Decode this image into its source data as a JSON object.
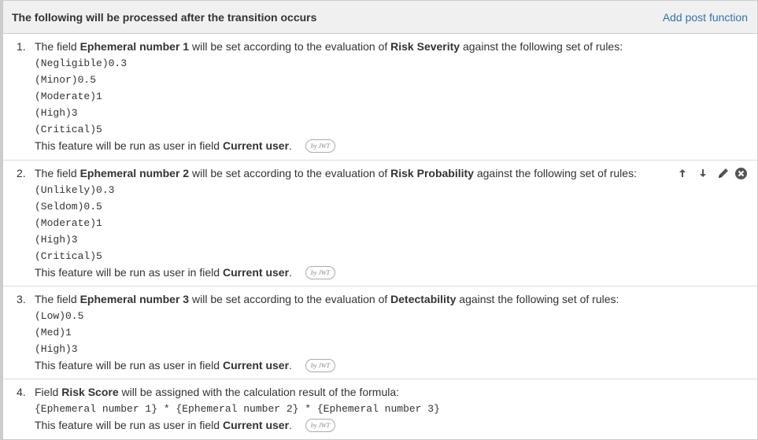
{
  "header": {
    "title": "The following will be processed after the transition occurs",
    "add_link": "Add post function"
  },
  "items": [
    {
      "num": "1.",
      "pre": "The field ",
      "field": "Ephemeral number 1",
      "mid": " will be set according to the evaluation of ",
      "source": "Risk Severity",
      "post": " against the following set of rules:",
      "rules": [
        "(Negligible)0.3",
        "(Minor)0.5",
        "(Moderate)1",
        "(High)3",
        "(Critical)5"
      ],
      "runas_text": "This feature will be run as user in field",
      "runas_field": "Current user",
      "runas_dot": ".",
      "badge": "by JWT"
    },
    {
      "num": "2.",
      "pre": "The field ",
      "field": "Ephemeral number 2",
      "mid": " will be set according to the evaluation of ",
      "source": "Risk Probability",
      "post": " against the following set of rules:",
      "rules": [
        "(Unlikely)0.3",
        "(Seldom)0.5",
        "(Moderate)1",
        "(High)3",
        "(Critical)5"
      ],
      "runas_text": "This feature will be run as user in field",
      "runas_field": "Current user",
      "runas_dot": ".",
      "badge": "by JWT"
    },
    {
      "num": "3.",
      "pre": "The field ",
      "field": "Ephemeral number 3",
      "mid": " will be set according to the evaluation of ",
      "source": "Detectability",
      "post": " against the following set of rules:",
      "rules": [
        "(Low)0.5",
        "(Med)1",
        "(High)3"
      ],
      "runas_text": "This feature will be run as user in field",
      "runas_field": "Current user",
      "runas_dot": ".",
      "badge": "by JWT"
    },
    {
      "num": "4.",
      "pre": "Field ",
      "field": "Risk Score",
      "post": " will be assigned with the calculation result of the formula:",
      "formula": "{Ephemeral number 1} * {Ephemeral number 2} * {Ephemeral number 3}",
      "runas_text": "This feature will be run as user in field",
      "runas_field": "Current user",
      "runas_dot": ".",
      "badge": "by JWT"
    }
  ],
  "icons": {
    "move_up": "arrow-up-icon",
    "move_down": "arrow-down-icon",
    "edit": "pencil-icon",
    "delete": "close-circle-icon"
  },
  "colors": {
    "link": "#3572b0",
    "header_bg": "#f0f0f0",
    "border": "#cccccc"
  }
}
